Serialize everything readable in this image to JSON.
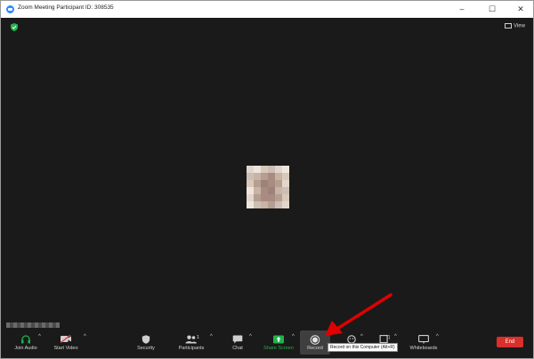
{
  "window": {
    "title": "Zoom Meeting Participant ID: 308535",
    "controls": {
      "minimize": "–",
      "maximize": "☐",
      "close": "✕"
    }
  },
  "top_bar": {
    "view_label": "View"
  },
  "toolbar": {
    "join_audio": "Join Audio",
    "start_video": "Start Video",
    "security": "Security",
    "participants": "Participants",
    "participants_count": "1",
    "chat": "Chat",
    "share_screen": "Share Screen",
    "record": "Record",
    "whiteboards": "Whiteboards",
    "end": "End",
    "caret": "^"
  },
  "tooltip": {
    "text": "Record on this Computer (Alt+R)"
  },
  "colors": {
    "background": "#1a1a1a",
    "share_green": "#22b24c",
    "end_red": "#d9302c",
    "arrow_red": "#e00000",
    "security_green": "#22b24c"
  },
  "icons": [
    "zoom-logo-icon",
    "shield-check-icon",
    "view-icon",
    "headphones-icon",
    "video-off-icon",
    "security-icon",
    "participants-icon",
    "chat-icon",
    "share-screen-icon",
    "record-icon",
    "reactions-icon",
    "apps-icon",
    "whiteboard-icon"
  ]
}
